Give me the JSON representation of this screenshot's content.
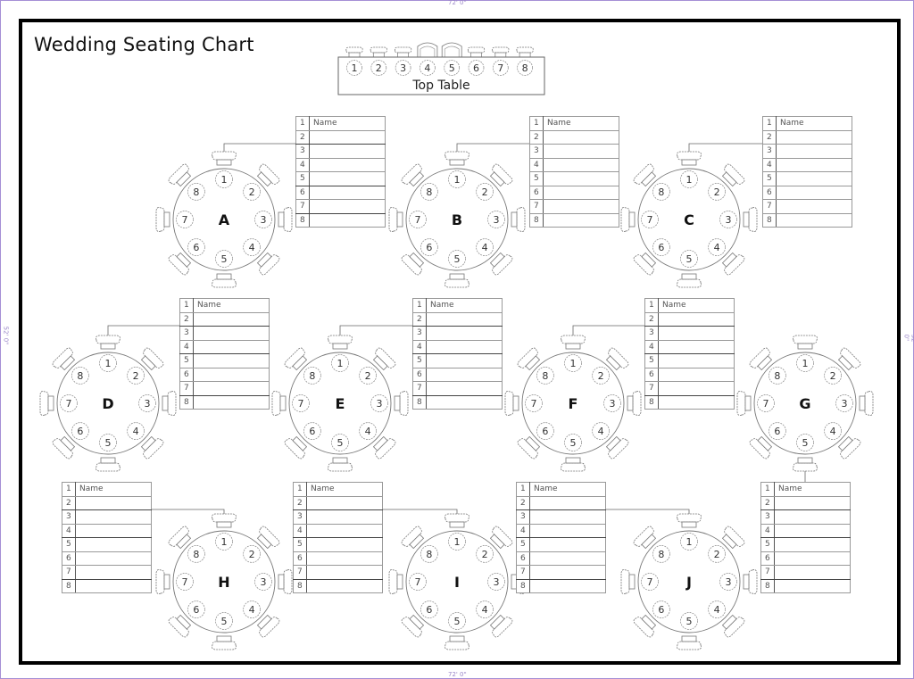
{
  "page": {
    "title": "Wedding Seating Chart",
    "ruler_label": "72' 0\"",
    "side_ruler_label": "52' 0\""
  },
  "top_table": {
    "label": "Top Table",
    "seats": [
      "1",
      "2",
      "3",
      "4",
      "5",
      "6",
      "7",
      "8"
    ]
  },
  "round_tables": [
    {
      "id": "A",
      "seats": [
        "1",
        "2",
        "3",
        "4",
        "5",
        "6",
        "7",
        "8"
      ]
    },
    {
      "id": "B",
      "seats": [
        "1",
        "2",
        "3",
        "4",
        "5",
        "6",
        "7",
        "8"
      ]
    },
    {
      "id": "C",
      "seats": [
        "1",
        "2",
        "3",
        "4",
        "5",
        "6",
        "7",
        "8"
      ]
    },
    {
      "id": "D",
      "seats": [
        "1",
        "2",
        "3",
        "4",
        "5",
        "6",
        "7",
        "8"
      ]
    },
    {
      "id": "E",
      "seats": [
        "1",
        "2",
        "3",
        "4",
        "5",
        "6",
        "7",
        "8"
      ]
    },
    {
      "id": "F",
      "seats": [
        "1",
        "2",
        "3",
        "4",
        "5",
        "6",
        "7",
        "8"
      ]
    },
    {
      "id": "G",
      "seats": [
        "1",
        "2",
        "3",
        "4",
        "5",
        "6",
        "7",
        "8"
      ]
    },
    {
      "id": "H",
      "seats": [
        "1",
        "2",
        "3",
        "4",
        "5",
        "6",
        "7",
        "8"
      ]
    },
    {
      "id": "I",
      "seats": [
        "1",
        "2",
        "3",
        "4",
        "5",
        "6",
        "7",
        "8"
      ]
    },
    {
      "id": "J",
      "seats": [
        "1",
        "2",
        "3",
        "4",
        "5",
        "6",
        "7",
        "8"
      ]
    }
  ],
  "guest_lists": [
    {
      "table": "A",
      "rows": [
        {
          "n": "1",
          "name": "Name"
        },
        {
          "n": "2",
          "name": ""
        },
        {
          "n": "3",
          "name": ""
        },
        {
          "n": "4",
          "name": ""
        },
        {
          "n": "5",
          "name": ""
        },
        {
          "n": "6",
          "name": ""
        },
        {
          "n": "7",
          "name": ""
        },
        {
          "n": "8",
          "name": ""
        }
      ]
    },
    {
      "table": "B",
      "rows": [
        {
          "n": "1",
          "name": "Name"
        },
        {
          "n": "2",
          "name": ""
        },
        {
          "n": "3",
          "name": ""
        },
        {
          "n": "4",
          "name": ""
        },
        {
          "n": "5",
          "name": ""
        },
        {
          "n": "6",
          "name": ""
        },
        {
          "n": "7",
          "name": ""
        },
        {
          "n": "8",
          "name": ""
        }
      ]
    },
    {
      "table": "C",
      "rows": [
        {
          "n": "1",
          "name": "Name"
        },
        {
          "n": "2",
          "name": ""
        },
        {
          "n": "3",
          "name": ""
        },
        {
          "n": "4",
          "name": ""
        },
        {
          "n": "5",
          "name": ""
        },
        {
          "n": "6",
          "name": ""
        },
        {
          "n": "7",
          "name": ""
        },
        {
          "n": "8",
          "name": ""
        }
      ]
    },
    {
      "table": "D",
      "rows": [
        {
          "n": "1",
          "name": "Name"
        },
        {
          "n": "2",
          "name": ""
        },
        {
          "n": "3",
          "name": ""
        },
        {
          "n": "4",
          "name": ""
        },
        {
          "n": "5",
          "name": ""
        },
        {
          "n": "6",
          "name": ""
        },
        {
          "n": "7",
          "name": ""
        },
        {
          "n": "8",
          "name": ""
        }
      ]
    },
    {
      "table": "E",
      "rows": [
        {
          "n": "1",
          "name": "Name"
        },
        {
          "n": "2",
          "name": ""
        },
        {
          "n": "3",
          "name": ""
        },
        {
          "n": "4",
          "name": ""
        },
        {
          "n": "5",
          "name": ""
        },
        {
          "n": "6",
          "name": ""
        },
        {
          "n": "7",
          "name": ""
        },
        {
          "n": "8",
          "name": ""
        }
      ]
    },
    {
      "table": "F",
      "rows": [
        {
          "n": "1",
          "name": "Name"
        },
        {
          "n": "2",
          "name": ""
        },
        {
          "n": "3",
          "name": ""
        },
        {
          "n": "4",
          "name": ""
        },
        {
          "n": "5",
          "name": ""
        },
        {
          "n": "6",
          "name": ""
        },
        {
          "n": "7",
          "name": ""
        },
        {
          "n": "8",
          "name": ""
        }
      ]
    },
    {
      "table": "G",
      "rows": [
        {
          "n": "1",
          "name": "Name"
        },
        {
          "n": "2",
          "name": ""
        },
        {
          "n": "3",
          "name": ""
        },
        {
          "n": "4",
          "name": ""
        },
        {
          "n": "5",
          "name": ""
        },
        {
          "n": "6",
          "name": ""
        },
        {
          "n": "7",
          "name": ""
        },
        {
          "n": "8",
          "name": ""
        }
      ]
    },
    {
      "table": "H",
      "rows": [
        {
          "n": "1",
          "name": "Name"
        },
        {
          "n": "2",
          "name": ""
        },
        {
          "n": "3",
          "name": ""
        },
        {
          "n": "4",
          "name": ""
        },
        {
          "n": "5",
          "name": ""
        },
        {
          "n": "6",
          "name": ""
        },
        {
          "n": "7",
          "name": ""
        },
        {
          "n": "8",
          "name": ""
        }
      ]
    },
    {
      "table": "I",
      "rows": [
        {
          "n": "1",
          "name": "Name"
        },
        {
          "n": "2",
          "name": ""
        },
        {
          "n": "3",
          "name": ""
        },
        {
          "n": "4",
          "name": ""
        },
        {
          "n": "5",
          "name": ""
        },
        {
          "n": "6",
          "name": ""
        },
        {
          "n": "7",
          "name": ""
        },
        {
          "n": "8",
          "name": ""
        }
      ]
    },
    {
      "table": "J",
      "rows": [
        {
          "n": "1",
          "name": "Name"
        },
        {
          "n": "2",
          "name": ""
        },
        {
          "n": "3",
          "name": ""
        },
        {
          "n": "4",
          "name": ""
        },
        {
          "n": "5",
          "name": ""
        },
        {
          "n": "6",
          "name": ""
        },
        {
          "n": "7",
          "name": ""
        },
        {
          "n": "8",
          "name": ""
        }
      ]
    }
  ],
  "colors": {
    "frame": "#000000",
    "line": "#555555",
    "ruler": "#a68fd6"
  }
}
